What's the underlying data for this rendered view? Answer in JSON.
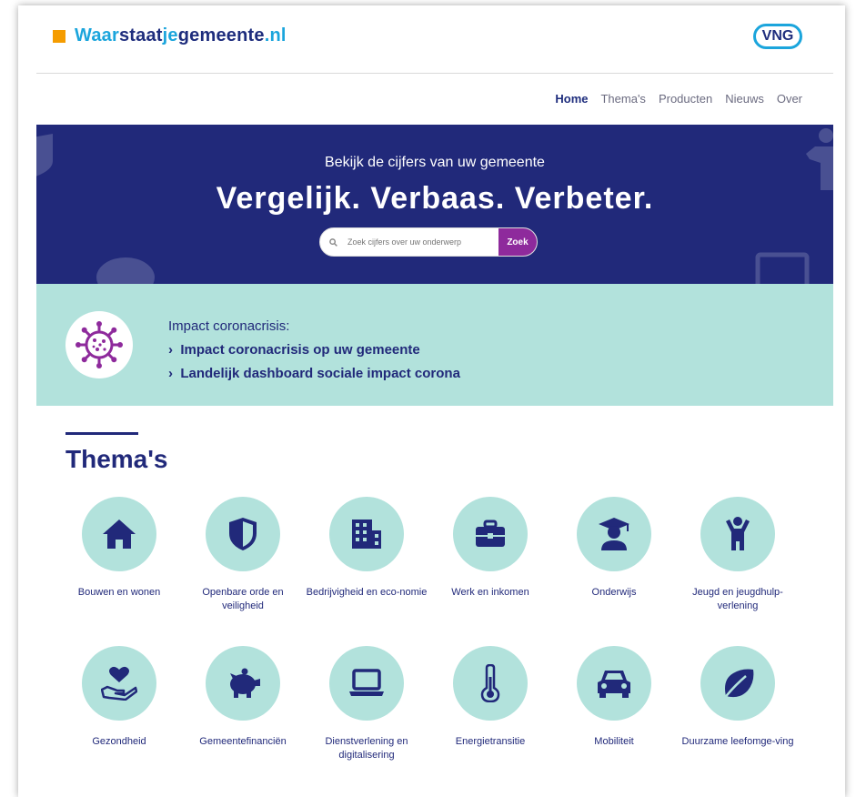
{
  "header": {
    "logo_part1": "Waar",
    "logo_part2": "staat",
    "logo_part3": "je",
    "logo_part4": "gemeente",
    "logo_part5": ".nl",
    "vng_label": "VNG"
  },
  "nav": {
    "items": [
      "Home",
      "Thema's",
      "Producten",
      "Nieuws",
      "Over"
    ],
    "active": "Home"
  },
  "hero": {
    "subtitle": "Bekijk de cijfers van uw gemeente",
    "title": "Vergelijk. Verbaas. Verbeter.",
    "search_placeholder": "Zoek cijfers over uw onderwerp",
    "search_button": "Zoek"
  },
  "corona": {
    "label": "Impact coronacrisis:",
    "links": [
      "Impact coronacrisis op uw gemeente",
      "Landelijk dashboard sociale impact corona"
    ],
    "icon": "virus-icon"
  },
  "themas": {
    "title": "Thema's",
    "items": [
      {
        "label": "Bouwen en wonen",
        "icon": "house-icon"
      },
      {
        "label": "Openbare orde en veiligheid",
        "icon": "shield-icon"
      },
      {
        "label": "Bedrijvigheid en eco-nomie",
        "icon": "building-icon"
      },
      {
        "label": "Werk en inkomen",
        "icon": "briefcase-icon"
      },
      {
        "label": "Onderwijs",
        "icon": "graduate-icon"
      },
      {
        "label": "Jeugd en jeugdhulp-verlening",
        "icon": "child-icon"
      },
      {
        "label": "Gezondheid",
        "icon": "heart-hand-icon"
      },
      {
        "label": "Gemeentefinanciën",
        "icon": "piggy-bank-icon"
      },
      {
        "label": "Dienstverlening en digitalisering",
        "icon": "laptop-icon"
      },
      {
        "label": "Energietransitie",
        "icon": "thermometer-icon"
      },
      {
        "label": "Mobiliteit",
        "icon": "car-icon"
      },
      {
        "label": "Duurzame leefomge-ving",
        "icon": "leaf-icon"
      }
    ]
  },
  "colors": {
    "navy": "#21297a",
    "mint": "#b2e2dc",
    "accent_purple": "#8e2a9c",
    "logo_orange": "#f59c00",
    "logo_blue": "#1ba5dc"
  }
}
